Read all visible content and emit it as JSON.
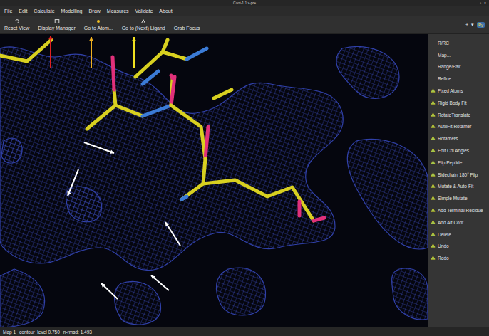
{
  "window": {
    "title": "Coot-1.1.x-pre",
    "controls": [
      "▫",
      "×"
    ]
  },
  "menu": [
    "File",
    "Edit",
    "Calculate",
    "Modelling",
    "Draw",
    "Measures",
    "Validate",
    "About"
  ],
  "toolbar": [
    {
      "label": "Reset View"
    },
    {
      "label": "Display Manager"
    },
    {
      "label": "Go to Atom..."
    },
    {
      "label": "Go to (Next) Ligand"
    },
    {
      "label": "Grab Focus"
    }
  ],
  "toolbar_right": {
    "add": "+",
    "dropdown": "▾",
    "python": "Py"
  },
  "side_buttons": [
    {
      "label": "R/RC",
      "kind": "plain"
    },
    {
      "label": "Map...",
      "kind": "plain"
    },
    {
      "label": "Range/Pair",
      "kind": "plain"
    },
    {
      "label": "Refine",
      "kind": "plain"
    },
    {
      "label": "Fixed Atoms",
      "kind": "icon"
    },
    {
      "label": "Rigid Body Fit",
      "kind": "icon"
    },
    {
      "label": "RotateTranslate",
      "kind": "icon"
    },
    {
      "label": "AutoFit Rotamer",
      "kind": "icon"
    },
    {
      "label": "Rotamers",
      "kind": "icon"
    },
    {
      "label": "Edit Chi Angles",
      "kind": "icon"
    },
    {
      "label": "Flip Peptide",
      "kind": "icon"
    },
    {
      "label": "Sidechain 180° Flip",
      "kind": "icon"
    },
    {
      "label": "Mutate & Auto-Fit",
      "kind": "icon"
    },
    {
      "label": "Simple Mutate",
      "kind": "icon"
    },
    {
      "label": "Add Terminal Residue",
      "kind": "icon"
    },
    {
      "label": "Add Alt Conf",
      "kind": "icon"
    },
    {
      "label": "Delete...",
      "kind": "icon"
    },
    {
      "label": "Undo",
      "kind": "icon"
    },
    {
      "label": "Redo",
      "kind": "icon"
    }
  ],
  "status_bar": {
    "map": "Map 1",
    "contour": "contour_level 0.750",
    "rmsd": "n-rmsd: 1.493"
  }
}
